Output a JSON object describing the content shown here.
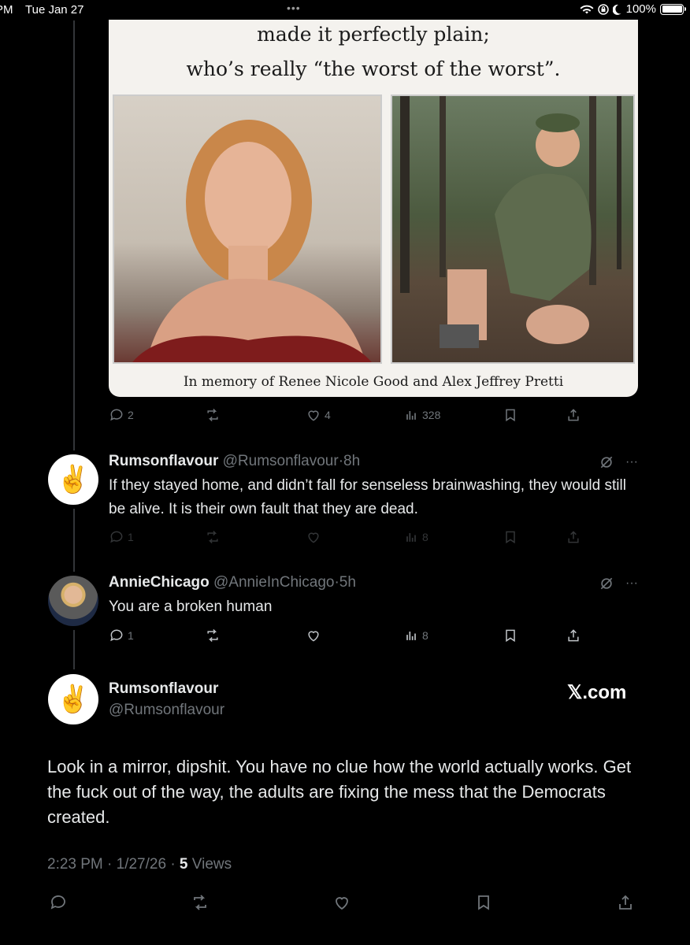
{
  "status_bar": {
    "time": "PM",
    "date": "Tue Jan 27",
    "battery": "100%"
  },
  "media": {
    "caption_line1": "made it perfectly plain;",
    "caption_line2": "who’s really “the worst of the worst”.",
    "caption_bottom": "In memory of Renee Nicole Good and Alex Jeffrey Pretti"
  },
  "media_tweet_actions": {
    "replies": "2",
    "likes": "4",
    "views": "328"
  },
  "replies": [
    {
      "name": "Rumsonflavour",
      "handle": "@Rumsonflavour",
      "time": "8h",
      "text": "If they stayed home, and didn’t fall for senseless brainwashing, they would still be alive. It is their own fault that they are dead.",
      "replies": "1",
      "views": "8",
      "avatar_icon": "peace-hand-icon"
    },
    {
      "name": "AnnieChicago",
      "handle": "@AnnieInChicago",
      "time": "5h",
      "text": "You are a broken human",
      "replies": "1",
      "views": "8",
      "avatar_icon": "profile-photo"
    }
  ],
  "main_tweet": {
    "name": "Rumsonflavour",
    "handle": "@Rumsonflavour",
    "brand": "𝕏.com",
    "text": "Look in a mirror, dipshit. You have no clue how the world actually works. Get the fuck out of the way, the adults are fixing the mess that the Democrats created.",
    "timestamp": "2:23 PM · 1/27/26 · ",
    "views_count": "5",
    "views_label": " Views"
  },
  "colors": {
    "background": "#000000",
    "text": "#e7e9ea",
    "muted": "#71767b"
  }
}
